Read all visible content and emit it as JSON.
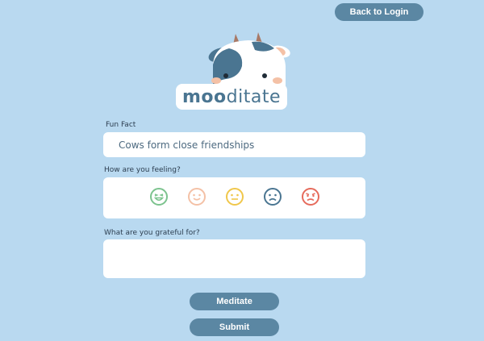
{
  "header": {
    "back_label": "Back to Login"
  },
  "logo": {
    "part1": "moo",
    "part2": "ditate"
  },
  "fun_fact": {
    "label": "Fun Fact",
    "text": "Cows form close friendships"
  },
  "feeling": {
    "label": "How are you feeling?",
    "moods": [
      {
        "icon": "laughing-face-icon",
        "color": "#7cc38e"
      },
      {
        "icon": "smiling-face-icon",
        "color": "#f4c1a6"
      },
      {
        "icon": "neutral-face-icon",
        "color": "#f0c74b"
      },
      {
        "icon": "sad-face-icon",
        "color": "#4a7591"
      },
      {
        "icon": "angry-face-icon",
        "color": "#e66b5c"
      }
    ]
  },
  "grateful": {
    "label": "What are you grateful for?",
    "value": ""
  },
  "actions": {
    "meditate_label": "Meditate",
    "submit_label": "Submit"
  },
  "colors": {
    "background": "#b9d9f0",
    "button": "#5b87a3",
    "accent": "#4a7591"
  }
}
